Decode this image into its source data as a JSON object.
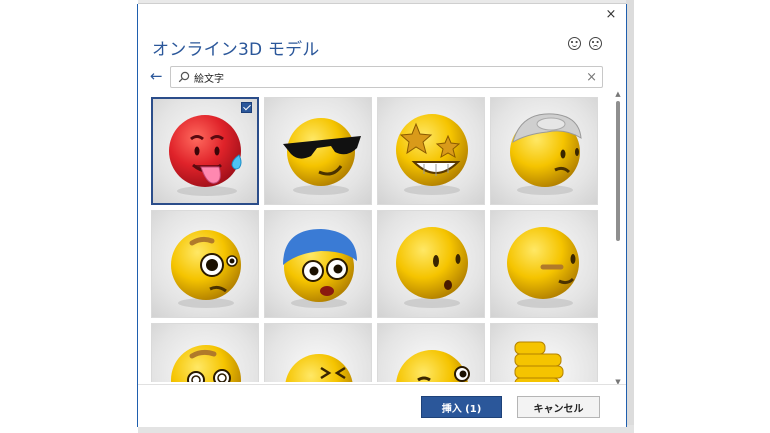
{
  "dialog": {
    "title": "オンライン3D モデル",
    "close_glyph": "×"
  },
  "feedback": {
    "happy_icon": "smile-feedback-icon",
    "sad_icon": "frown-feedback-icon"
  },
  "search": {
    "back_glyph": "←",
    "icon": "search-icon",
    "value": "絵文字",
    "clear_glyph": "×"
  },
  "results": [
    {
      "name": "hot-face-emoji",
      "selected": true
    },
    {
      "name": "sunglasses-smirk-emoji",
      "selected": false
    },
    {
      "name": "star-struck-emoji",
      "selected": false
    },
    {
      "name": "head-bandage-emoji",
      "selected": false
    },
    {
      "name": "pleading-eyebrow-emoji",
      "selected": false
    },
    {
      "name": "blue-cap-surprised-emoji",
      "selected": false
    },
    {
      "name": "hushed-face-emoji",
      "selected": false
    },
    {
      "name": "raised-eyebrow-emoji",
      "selected": false
    },
    {
      "name": "dizzy-eyes-emoji",
      "selected": false
    },
    {
      "name": "squinting-face-emoji",
      "selected": false
    },
    {
      "name": "winking-face-emoji",
      "selected": false
    },
    {
      "name": "thumbs-down-emoji",
      "selected": false
    }
  ],
  "scrollbar": {
    "up_glyph": "▲",
    "down_glyph": "▼"
  },
  "footer": {
    "insert_label": "挿入 (1)",
    "cancel_label": "キャンセル"
  },
  "colors": {
    "accent": "#2b579a",
    "emoji_yellow": "#f5c400",
    "emoji_red": "#e0232a"
  }
}
